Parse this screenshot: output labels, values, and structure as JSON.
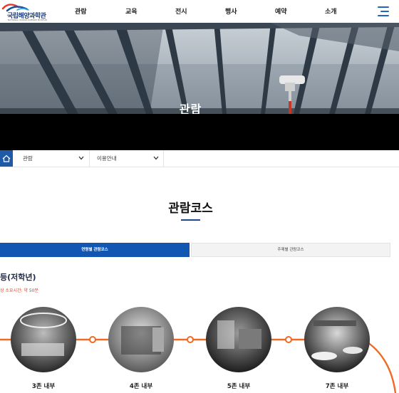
{
  "header": {
    "logo": {
      "name": "국립해양과학관",
      "subtitle": "NATIONAL OCEAN SCIENCE MUSEUM"
    },
    "nav": [
      "관람",
      "교육",
      "전시",
      "행사",
      "예약",
      "소개"
    ],
    "menu_icon": "hamburger-icon"
  },
  "hero": {
    "title": "관람"
  },
  "breadcrumb": {
    "home_icon": "home-icon",
    "items": [
      "관람",
      "이용안내"
    ]
  },
  "page": {
    "title": "관람코스"
  },
  "tabs": [
    {
      "label": "연령별 관람코스",
      "active": true
    },
    {
      "label": "주제별 관람코스",
      "active": false
    }
  ],
  "course": {
    "title": "등(저학년)",
    "time": "상 소요시간: 약 50분",
    "stops": [
      "3존 내부",
      "4존 내부",
      "5존 내부",
      "7존 내부"
    ]
  },
  "colors": {
    "primary": "#1256b3",
    "route": "#ef6a22",
    "accent_red": "#e23a1e"
  }
}
